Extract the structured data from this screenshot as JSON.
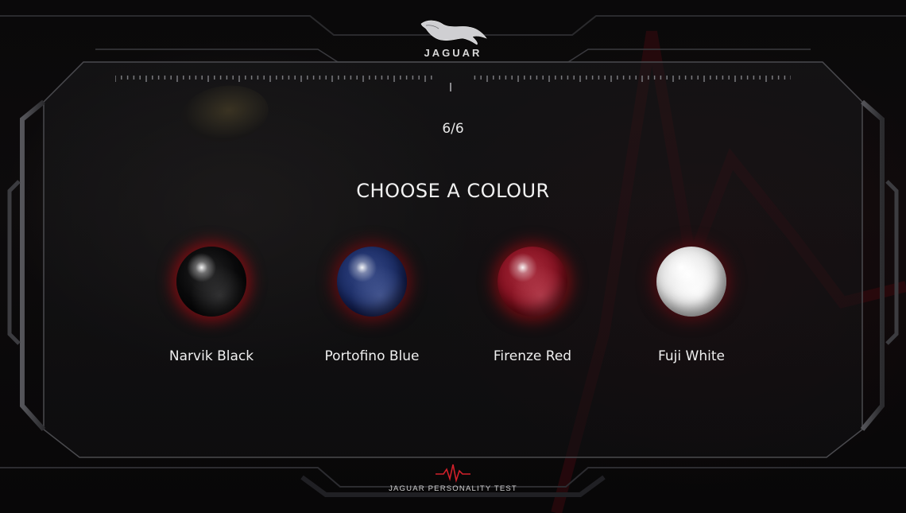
{
  "brand": {
    "wordmark": "JAGUAR"
  },
  "quiz": {
    "progress": "6/6",
    "title": "CHOOSE A COLOUR",
    "options": [
      {
        "label": "Narvik Black",
        "color": "#0b0b0c",
        "glow": "#7a0d12"
      },
      {
        "label": "Portofino Blue",
        "color": "#1d2f6a",
        "glow": "#5a0d12"
      },
      {
        "label": "Firenze Red",
        "color": "#8c1424",
        "glow": "#6a0d12"
      },
      {
        "label": "Fuji White",
        "color": "#e6e6e6",
        "glow": "#4a0d12"
      }
    ]
  },
  "footer": {
    "label": "JAGUAR PERSONALITY TEST",
    "accent": "#d0202a"
  },
  "icons": {
    "logo": "jaguar-leaper-icon",
    "footer": "heartbeat-pulse-icon"
  }
}
